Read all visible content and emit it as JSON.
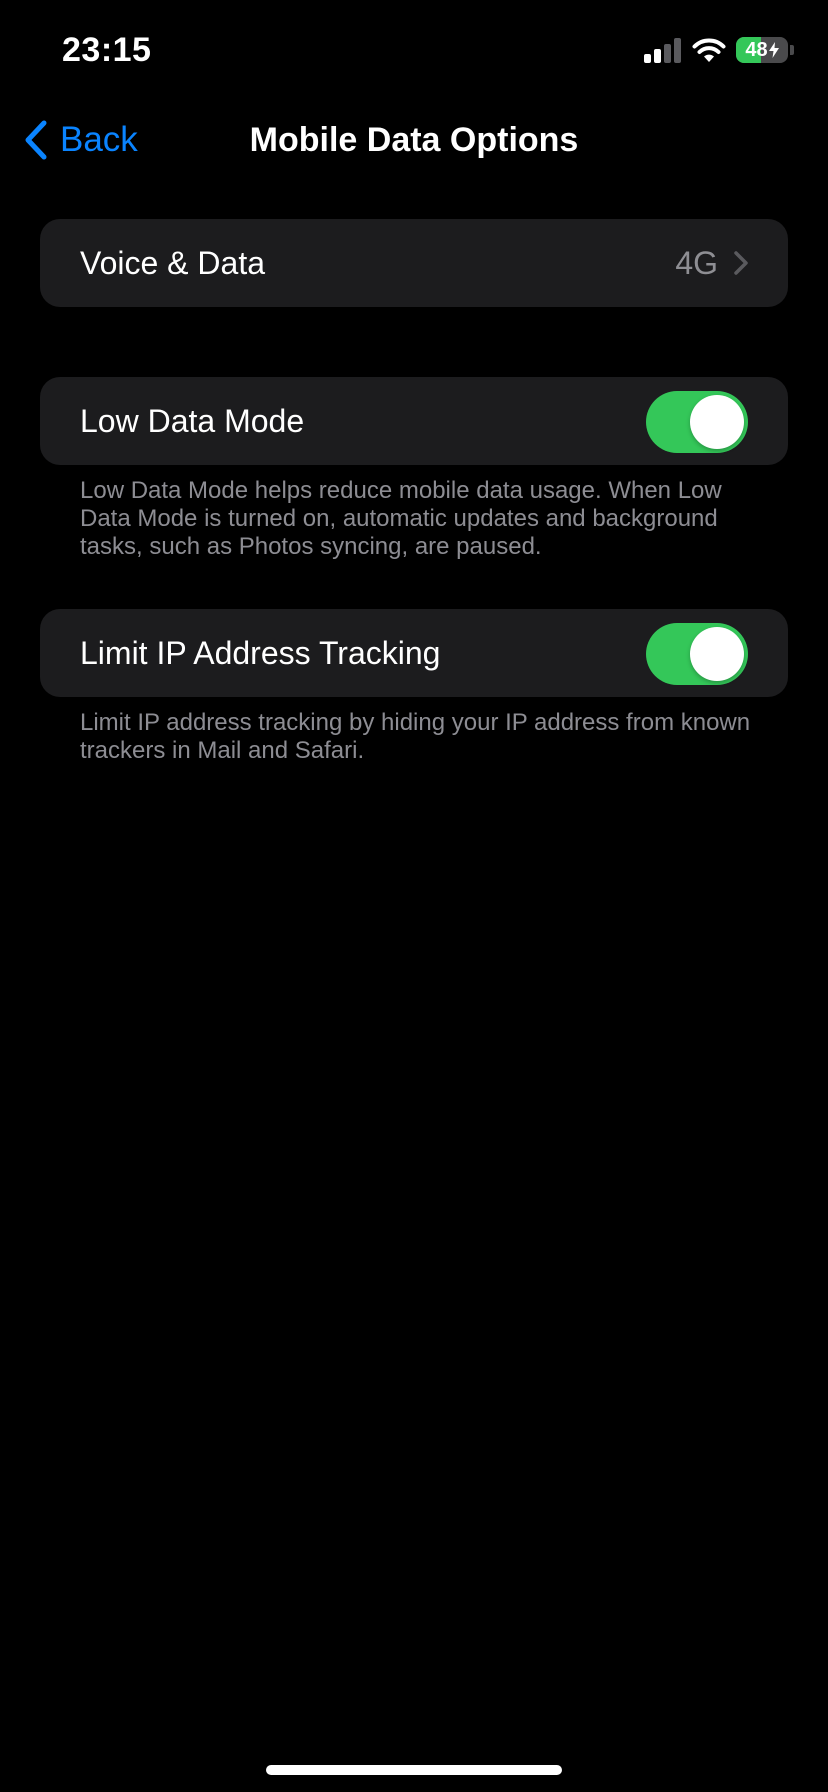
{
  "status_bar": {
    "time": "23:15",
    "battery_percent": "48",
    "battery_level": 0.48,
    "signal_bars_active": 2,
    "signal_bars_total": 4
  },
  "nav": {
    "back_label": "Back",
    "title": "Mobile Data Options"
  },
  "voice_data": {
    "label": "Voice & Data",
    "value": "4G"
  },
  "low_data_mode": {
    "label": "Low Data Mode",
    "enabled": true,
    "footer": "Low Data Mode helps reduce mobile data usage. When Low Data Mode is turned on, automatic updates and background tasks, such as Photos syncing, are paused."
  },
  "limit_ip": {
    "label": "Limit IP Address Tracking",
    "enabled": true,
    "footer": "Limit IP address tracking by hiding your IP address from known trackers in Mail and Safari."
  },
  "colors": {
    "accent": "#0a84ff",
    "toggle_on": "#34c759",
    "cell_background": "#1c1c1e",
    "secondary_text": "#8e8e93"
  },
  "icons": {
    "back": "chevron-left-icon",
    "disclosure": "chevron-right-icon",
    "signal": "cellular-signal-icon",
    "wifi": "wifi-icon",
    "battery": "battery-icon",
    "charging": "bolt-icon"
  }
}
